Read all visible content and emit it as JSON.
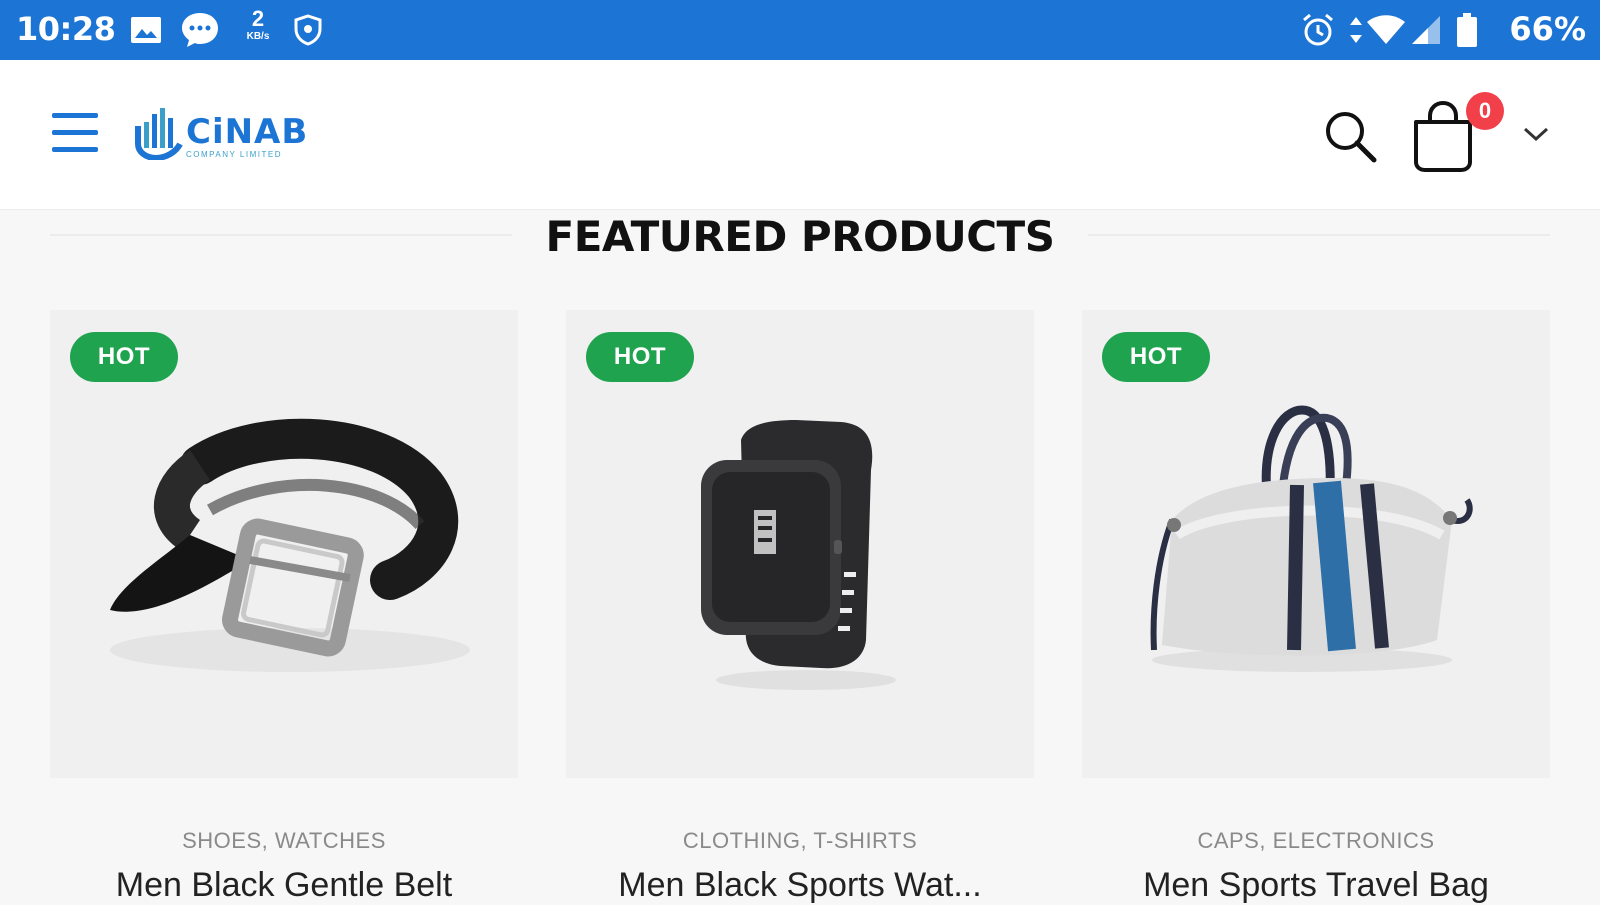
{
  "status_bar": {
    "time": "10:28",
    "speed_value": "2",
    "speed_unit": "KB/s",
    "battery_percent": "66%",
    "icons": [
      "gallery-icon",
      "chat-bubble-icon",
      "network-speed-icon",
      "vpn-shield-icon",
      "alarm-icon",
      "data-arrows-icon",
      "wifi-icon",
      "cell-signal-icon",
      "battery-icon"
    ],
    "color": "#1c74d4"
  },
  "header": {
    "logo_text": "CiNAB",
    "logo_subtext": "COMPANY LIMITED",
    "cart_count": "0",
    "icons": [
      "hamburger-menu-icon",
      "search-icon",
      "shopping-bag-icon",
      "chevron-down-icon"
    ]
  },
  "section": {
    "title": "FEATURED PRODUCTS"
  },
  "products": [
    {
      "badge": "HOT",
      "categories": "SHOES, WATCHES",
      "name": "Men Black Gentle Belt",
      "image": "belt-image"
    },
    {
      "badge": "HOT",
      "categories": "CLOTHING, T-SHIRTS",
      "name": "Men Black Sports Wat...",
      "image": "smartwatch-image"
    },
    {
      "badge": "HOT",
      "categories": "CAPS, ELECTRONICS",
      "name": "Men Sports Travel Bag",
      "image": "travel-bag-image"
    }
  ],
  "colors": {
    "brand_blue": "#1c74d4",
    "hot_badge_green": "#1fa34f",
    "cart_badge_red": "#f2404a"
  }
}
